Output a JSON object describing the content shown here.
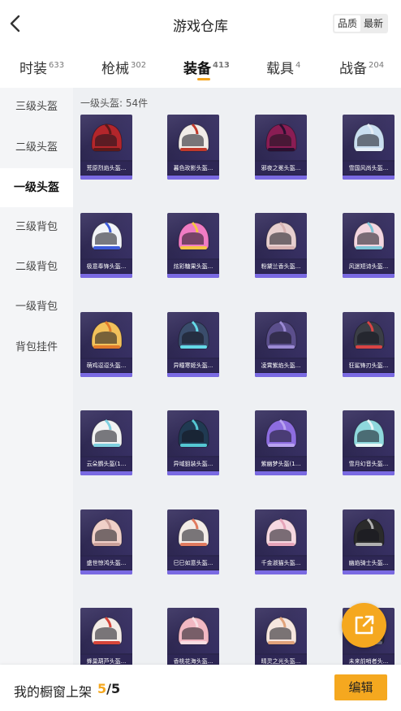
{
  "header": {
    "title": "游戏仓库",
    "sort_options": [
      "品质",
      "最新"
    ],
    "active_sort": 0
  },
  "tabs": [
    {
      "label": "时装",
      "count": "633"
    },
    {
      "label": "枪械",
      "count": "302"
    },
    {
      "label": "装备",
      "count": "413"
    },
    {
      "label": "载具",
      "count": "4"
    },
    {
      "label": "战备",
      "count": "204"
    }
  ],
  "active_tab": 2,
  "sidebar": {
    "items": [
      "三级头盔",
      "二级头盔",
      "一级头盔",
      "三级背包",
      "二级背包",
      "一级背包",
      "背包挂件"
    ],
    "active_index": 2
  },
  "section": {
    "label": "一级头盔: 54件"
  },
  "items": [
    {
      "name": "荒原烈焰头盔...",
      "color": "#b3262b",
      "accent": "#5b1a1a"
    },
    {
      "name": "暮色玫影头盔...",
      "color": "#f1ece8",
      "accent": "#c0392b"
    },
    {
      "name": "邪夜之冕头盔...",
      "color": "#8a1d54",
      "accent": "#2b1030"
    },
    {
      "name": "雪国风尚头盔...",
      "color": "#c9def0",
      "accent": "#e6eef6"
    },
    {
      "name": "极意奉锋头盔...",
      "color": "#f2f4f8",
      "accent": "#3d5bd9"
    },
    {
      "name": "炫彩糖果头盔...",
      "color": "#f07cc4",
      "accent": "#f5c542"
    },
    {
      "name": "粉黛兰香头盔...",
      "color": "#e7cfcf",
      "accent": "#d7b2b2"
    },
    {
      "name": "风迷短诗头盔...",
      "color": "#f3d6e0",
      "accent": "#7fc6d8"
    },
    {
      "name": "萌鸡逗逗头盔...",
      "color": "#f2c15b",
      "accent": "#e27a2b"
    },
    {
      "name": "异瞳寒姬头盔...",
      "color": "#3a4d6c",
      "accent": "#64d9e8"
    },
    {
      "name": "凌霄紫焰头盔...",
      "color": "#5b4f8c",
      "accent": "#9b8ad4"
    },
    {
      "name": "狂鲨锋刃头盔...",
      "color": "#3b3e46",
      "accent": "#d84444"
    },
    {
      "name": "云朵鹦头盔(1...",
      "color": "#f2f2f2",
      "accent": "#7fd0e0"
    },
    {
      "name": "异域狙装头盔...",
      "color": "#203a52",
      "accent": "#55c7d3"
    },
    {
      "name": "紫幽梦头盔(1...",
      "color": "#8d6de0",
      "accent": "#b8a2f0"
    },
    {
      "name": "雪月幻音头盔...",
      "color": "#8fd8dd",
      "accent": "#e9f6f7"
    },
    {
      "name": "盛世惊鸿头盔...",
      "color": "#f0d0c8",
      "accent": "#c9a09a"
    },
    {
      "name": "巳巳如意头盔...",
      "color": "#f3ece7",
      "accent": "#e07a5f"
    },
    {
      "name": "千金淑猫头盔...",
      "color": "#f6d8e1",
      "accent": "#e6a4b9"
    },
    {
      "name": "幽焰骑士头盔...",
      "color": "#2b2b2b",
      "accent": "#b0b0b0"
    },
    {
      "name": "蜂巢葫芦头盔...",
      "color": "#f3ece7",
      "accent": "#d6453a"
    },
    {
      "name": "香桃花海头盔...",
      "color": "#f2b8c3",
      "accent": "#f7dde2"
    },
    {
      "name": "晴灵之光头盔...",
      "color": "#f6e6de",
      "accent": "#e0a27a"
    },
    {
      "name": "未来前哨者头...",
      "color": "#2a2a3a",
      "accent": "#6b6b7e"
    }
  ],
  "footer": {
    "label": "我的橱窗上架",
    "current": "5",
    "total": "/5",
    "edit_label": "编辑"
  },
  "colors": {
    "accent": "#f5a81f",
    "card_bg": "#2e2755",
    "card_border": "#7a6ae2"
  }
}
